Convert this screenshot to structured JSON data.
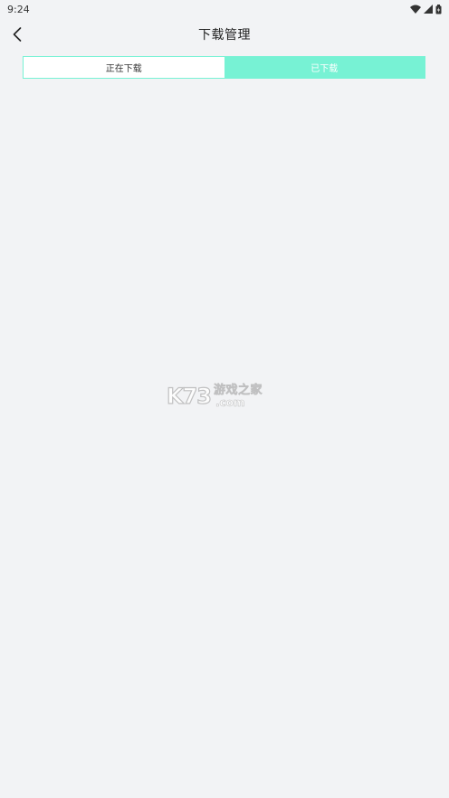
{
  "status_bar": {
    "time": "9:24",
    "icons": [
      "wifi-icon",
      "signal-icon",
      "battery-icon"
    ]
  },
  "nav": {
    "back_icon": "chevron-left-icon",
    "title": "下载管理"
  },
  "tabs": [
    {
      "label": "正在下载",
      "active": false
    },
    {
      "label": "已下载",
      "active": true
    }
  ],
  "watermark": {
    "logo": "K73",
    "tagline": "游戏之家",
    "domain": ".com"
  },
  "colors": {
    "accent": "#77f2d4",
    "background": "#f2f3f5"
  }
}
